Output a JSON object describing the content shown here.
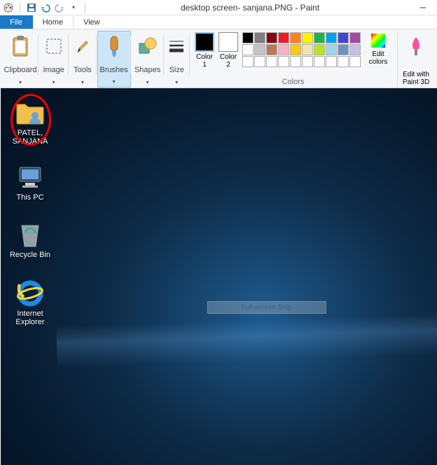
{
  "title": "desktop screen- sanjana.PNG - Paint",
  "tabs": {
    "file": "File",
    "home": "Home",
    "view": "View"
  },
  "ribbon": {
    "clipboard": "Clipboard",
    "image": "Image",
    "tools": "Tools",
    "brushes": "Brushes",
    "shapes": "Shapes",
    "size": "Size",
    "color1": "Color\n1",
    "color2": "Color\n2",
    "colors_label": "Colors",
    "edit_colors": "Edit\ncolors",
    "edit_paint3d": "Edit with\nPaint 3D"
  },
  "color1_value": "#000000",
  "color2_value": "#ffffff",
  "palette_row1": [
    "#000000",
    "#7f7f7f",
    "#880015",
    "#ed1c24",
    "#ff7f27",
    "#fff200",
    "#22b14c",
    "#00a2e8",
    "#3f48cc",
    "#a349a4"
  ],
  "palette_row2": [
    "#ffffff",
    "#c3c3c3",
    "#b97a57",
    "#ffaec9",
    "#ffc90e",
    "#efe4b0",
    "#b5e61d",
    "#99d9ea",
    "#7092be",
    "#c8bfe7"
  ],
  "palette_row3": [
    "#ffffff",
    "#ffffff",
    "#ffffff",
    "#ffffff",
    "#ffffff",
    "#ffffff",
    "#ffffff",
    "#ffffff",
    "#ffffff",
    "#ffffff"
  ],
  "desktop_icons": {
    "user_folder": "PATEL, SANJANA",
    "this_pc": "This PC",
    "recycle_bin": "Recycle Bin",
    "ie": "Internet Explorer"
  },
  "snip_text": "Full-screen Snip"
}
